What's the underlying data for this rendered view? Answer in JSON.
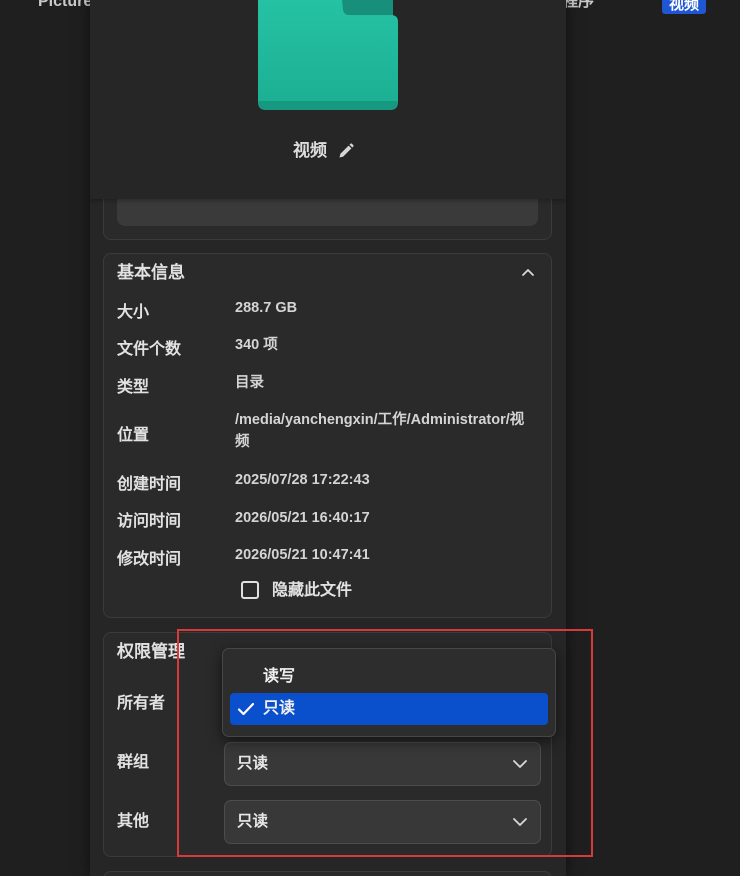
{
  "background": {
    "left_item": "Picture",
    "right_item": "程序",
    "active_badge": "视频"
  },
  "header": {
    "folder_icon": "folder-icon",
    "folder_name": "视频",
    "edit_icon": "pencil-icon"
  },
  "basic_info": {
    "title": "基本信息",
    "collapse_icon": "chevron-up-icon",
    "rows": [
      {
        "label": "大小",
        "value": "288.7 GB"
      },
      {
        "label": "文件个数",
        "value": "340 项"
      },
      {
        "label": "类型",
        "value": "目录"
      },
      {
        "label": "位置",
        "value": "/media/yanchengxin/工作/Administrator/视频"
      },
      {
        "label": "创建时间",
        "value": "2025/07/28 17:22:43"
      },
      {
        "label": "访问时间",
        "value": "2026/05/21 16:40:17"
      },
      {
        "label": "修改时间",
        "value": "2026/05/21 10:47:41"
      }
    ],
    "hide_file": {
      "label": "隐藏此文件",
      "checked": false
    }
  },
  "permissions": {
    "title": "权限管理",
    "collapse_icon": "chevron-up-icon",
    "owner": {
      "label": "所有者"
    },
    "group": {
      "label": "群组",
      "value": "只读"
    },
    "other": {
      "label": "其他",
      "value": "只读"
    },
    "owner_dropdown": {
      "open": true,
      "options": [
        {
          "label": "读写",
          "selected": false
        },
        {
          "label": "只读",
          "selected": true
        }
      ]
    }
  },
  "colors": {
    "page_bg": "#1f1f1f",
    "panel_bg": "#262626",
    "section_bg": "#2a2a2a",
    "folder": "#22bc9f",
    "selected_option": "#0a4fcb",
    "badge": "#1f56d3",
    "highlight_border": "#d73a3a"
  }
}
